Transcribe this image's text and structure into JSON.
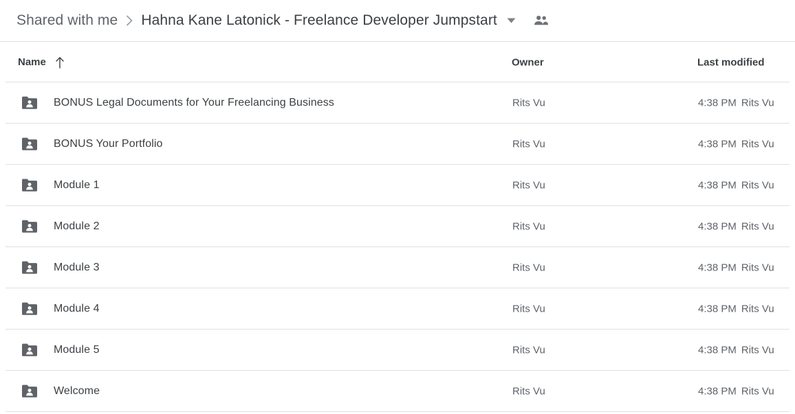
{
  "colors": {
    "text_primary": "#3c4043",
    "text_secondary": "#5f6368",
    "divider": "#e0e0e0",
    "folder_icon": "#5f6368",
    "background": "#ffffff"
  },
  "breadcrumb": {
    "parent": "Shared with me",
    "separator_icon": "chevron-right-icon",
    "current": "Hahna Kane Latonick - Freelance Developer Jumpstart",
    "caret_icon": "caret-down-icon",
    "people_icon": "people-icon"
  },
  "table": {
    "headers": {
      "name": "Name",
      "sort_icon": "arrow-up-icon",
      "owner": "Owner",
      "last_modified": "Last modified"
    },
    "rows": [
      {
        "icon": "shared-folder-icon",
        "name": "BONUS Legal Documents for Your Freelancing Business",
        "owner": "Rits Vu",
        "modified_time": "4:38 PM",
        "modified_by": "Rits Vu"
      },
      {
        "icon": "shared-folder-icon",
        "name": "BONUS Your Portfolio",
        "owner": "Rits Vu",
        "modified_time": "4:38 PM",
        "modified_by": "Rits Vu"
      },
      {
        "icon": "shared-folder-icon",
        "name": "Module 1",
        "owner": "Rits Vu",
        "modified_time": "4:38 PM",
        "modified_by": "Rits Vu"
      },
      {
        "icon": "shared-folder-icon",
        "name": "Module 2",
        "owner": "Rits Vu",
        "modified_time": "4:38 PM",
        "modified_by": "Rits Vu"
      },
      {
        "icon": "shared-folder-icon",
        "name": "Module 3",
        "owner": "Rits Vu",
        "modified_time": "4:38 PM",
        "modified_by": "Rits Vu"
      },
      {
        "icon": "shared-folder-icon",
        "name": "Module 4",
        "owner": "Rits Vu",
        "modified_time": "4:38 PM",
        "modified_by": "Rits Vu"
      },
      {
        "icon": "shared-folder-icon",
        "name": "Module 5",
        "owner": "Rits Vu",
        "modified_time": "4:38 PM",
        "modified_by": "Rits Vu"
      },
      {
        "icon": "shared-folder-icon",
        "name": "Welcome",
        "owner": "Rits Vu",
        "modified_time": "4:38 PM",
        "modified_by": "Rits Vu"
      }
    ]
  }
}
